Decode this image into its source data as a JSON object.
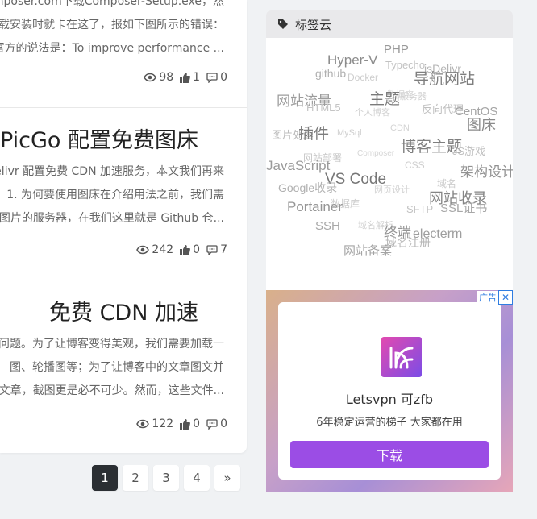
{
  "posts": [
    {
      "excerpt": [
        "composer.com下载Composer-Setup.exe，然",
        "载安装时就卡在这了，报如下图所示的错误：",
        "官方的说法是：To improve performance ..."
      ],
      "views": "98",
      "likes": "1",
      "comments": "0"
    },
    {
      "title": "PicGo 配置免费图床",
      "excerpt": [
        "Delivr 配置免费 CDN 加速服务，本文我们再来",
        "1. 为何要使用图床在介绍用法之前，我们需",
        "图片的服务器，在我们这里就是 Github 仓..."
      ],
      "views": "242",
      "likes": "0",
      "comments": "7"
    },
    {
      "title": "免费 CDN 加速",
      "excerpt": [
        "问题。为了让博客变得美观，我们需要加载一",
        "图、轮播图等；为了让博客中的文章图文并",
        "文章，截图更是必不可少。然而，这些文件..."
      ],
      "views": "122",
      "likes": "0",
      "comments": "0"
    }
  ],
  "pagination": [
    "1",
    "2",
    "3",
    "4",
    "»"
  ],
  "pagination_active": "1",
  "tagcloud": {
    "title": "标签云",
    "icon": "tags-icon",
    "tags": [
      {
        "text": "PHP",
        "size": 15,
        "color": "#9a9a9a"
      },
      {
        "text": "Hyper-V",
        "size": 17,
        "color": "#8c8c8c"
      },
      {
        "text": "Typecho",
        "size": 13,
        "color": "#c2c2c2"
      },
      {
        "text": "jsDelivr",
        "size": 14,
        "color": "#b4b4b4"
      },
      {
        "text": "github",
        "size": 14,
        "color": "#b0b0b0"
      },
      {
        "text": "Docker",
        "size": 12,
        "color": "#cdcdcd"
      },
      {
        "text": "导航网站",
        "size": 19,
        "color": "#7f7f7f"
      },
      {
        "text": "数据库",
        "size": 11,
        "color": "#d4d4d4"
      },
      {
        "text": "网站流量",
        "size": 17,
        "color": "#9c9c9c"
      },
      {
        "text": "主题",
        "size": 19,
        "color": "#7a7a7a"
      },
      {
        "text": "服务器",
        "size": 11,
        "color": "#d2d2d2"
      },
      {
        "text": "HTML5",
        "size": 13,
        "color": "#c4c4c4"
      },
      {
        "text": "个人博客",
        "size": 11,
        "color": "#d2d2d2"
      },
      {
        "text": "反向代理",
        "size": 13,
        "color": "#c0c0c0"
      },
      {
        "text": "CentOS",
        "size": 15,
        "color": "#a4a4a4"
      },
      {
        "text": "图床",
        "size": 18,
        "color": "#8a8a8a"
      },
      {
        "text": "图片处理",
        "size": 13,
        "color": "#bcbcbc"
      },
      {
        "text": "插件",
        "size": 19,
        "color": "#7d7d7d"
      },
      {
        "text": "MySql",
        "size": 11,
        "color": "#d0d0d0"
      },
      {
        "text": "CDN",
        "size": 11,
        "color": "#d4d4d4"
      },
      {
        "text": "博客主题",
        "size": 19,
        "color": "#7f7f7f"
      },
      {
        "text": "JS游戏",
        "size": 13,
        "color": "#c0c0c0"
      },
      {
        "text": "网站部署",
        "size": 12,
        "color": "#c8c8c8"
      },
      {
        "text": "Composer",
        "size": 10,
        "color": "#d6d6d6"
      },
      {
        "text": "JavaScript",
        "size": 17,
        "color": "#9a9a9a"
      },
      {
        "text": "CSS",
        "size": 12,
        "color": "#cdcdcd"
      },
      {
        "text": "架构设计",
        "size": 17,
        "color": "#909090"
      },
      {
        "text": "VS Code",
        "size": 19,
        "color": "#777777"
      },
      {
        "text": "域名",
        "size": 12,
        "color": "#cdcdcd"
      },
      {
        "text": "Google收录",
        "size": 14,
        "color": "#b0b0b0"
      },
      {
        "text": "网页设计",
        "size": 11,
        "color": "#d2d2d2"
      },
      {
        "text": "网站收录",
        "size": 18,
        "color": "#858585"
      },
      {
        "text": "数据库",
        "size": 12,
        "color": "#cdcdcd"
      },
      {
        "text": "Portainer",
        "size": 17,
        "color": "#959595"
      },
      {
        "text": "SFTP",
        "size": 13,
        "color": "#c2c2c2"
      },
      {
        "text": "SSL证书",
        "size": 15,
        "color": "#a8a8a8"
      },
      {
        "text": "域名解析",
        "size": 11,
        "color": "#d0d0d0"
      },
      {
        "text": "SSH",
        "size": 15,
        "color": "#a8a8a8"
      },
      {
        "text": "终端",
        "size": 17,
        "color": "#949494"
      },
      {
        "text": "electerm",
        "size": 16,
        "color": "#9e9e9e"
      },
      {
        "text": "域名注册",
        "size": 14,
        "color": "#b6b6b6"
      },
      {
        "text": "网站备案",
        "size": 15,
        "color": "#a4a4a4"
      }
    ]
  },
  "ad": {
    "label": "广告",
    "close": "✕",
    "brand": "Letsvpn 可zfb",
    "slogan": "6年稳定运营的梯子 大家都在用",
    "button": "下载",
    "gradient_colors": [
      "#d9b08a",
      "#c7a0c8",
      "#a78fd6",
      "#e6a6b8"
    ],
    "button_color": "#9b4de5"
  }
}
